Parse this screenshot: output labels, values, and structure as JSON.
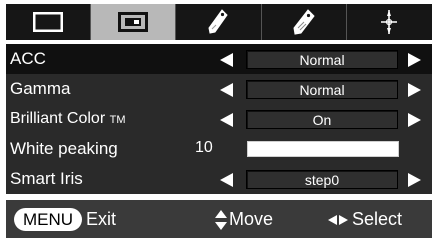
{
  "tabs": [
    {
      "icon": "monitor-icon",
      "active": false
    },
    {
      "icon": "picture-settings-icon",
      "active": true
    },
    {
      "icon": "tag-icon",
      "active": false
    },
    {
      "icon": "settings-tag-icon",
      "active": false
    },
    {
      "icon": "compass-icon",
      "active": false
    }
  ],
  "menu": {
    "rows": [
      {
        "label": "ACC",
        "value": "Normal",
        "selected": true
      },
      {
        "label": "Gamma",
        "value": "Normal"
      },
      {
        "label": "Brilliant Color",
        "label_suffix": "TM",
        "value": "On"
      },
      {
        "label": "White peaking",
        "number": "10",
        "level": 1.0
      },
      {
        "label": "Smart Iris",
        "value": "step0"
      }
    ]
  },
  "footer": {
    "menu_key": "MENU",
    "exit_label": "Exit",
    "move_label": "Move",
    "select_label": "Select"
  },
  "colors": {
    "panel": "#2a2a2a",
    "selected_row": "#101010",
    "active_tab": "#b8b8b8",
    "tab_strip": "#161616",
    "text": "#ffffff"
  }
}
